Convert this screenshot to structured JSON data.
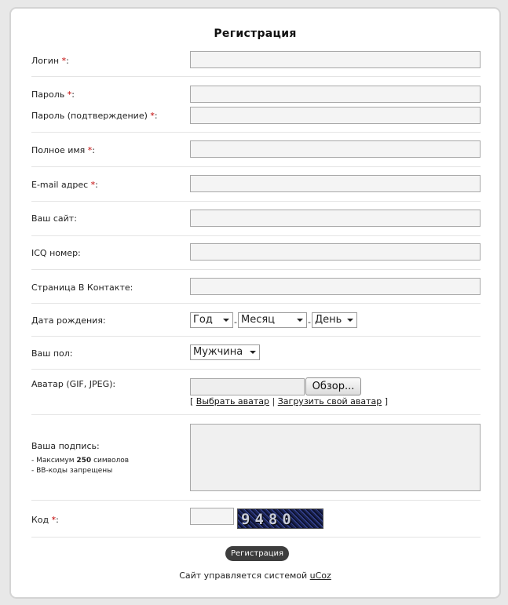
{
  "title": "Регистрация",
  "required_mark": "*",
  "fields": {
    "login": "Логин",
    "password": "Пароль",
    "password_confirm": "Пароль (подтверждение)",
    "fullname": "Полное имя",
    "email": "E-mail адрес",
    "site": "Ваш сайт:",
    "icq": "ICQ номер:",
    "vk": "Страница В Контакте:",
    "birthdate": "Дата рождения:",
    "gender": "Ваш пол:",
    "avatar": "Аватар (GIF, JPEG):",
    "signature": "Ваша подпись:",
    "code": "Код"
  },
  "colon": ":",
  "birth": {
    "year": "Год",
    "month": "Месяц",
    "day": "День",
    "separator": "-"
  },
  "gender_value": "Мужчина",
  "avatar": {
    "browse_label": "Обзор...",
    "open_bracket": "[",
    "choose_link": "Выбрать аватар",
    "divider": "|",
    "upload_link": "Загрузить свой аватар",
    "close_bracket": "]"
  },
  "signature_notes": {
    "max_prefix": "- Максимум",
    "max_value": "250",
    "max_suffix": "символов",
    "bbcode": "- BB-коды запрещены"
  },
  "captcha_text": "9480",
  "submit_label": "Регистрация",
  "footer": {
    "text": "Сайт управляется системой",
    "link": "uCoz"
  }
}
